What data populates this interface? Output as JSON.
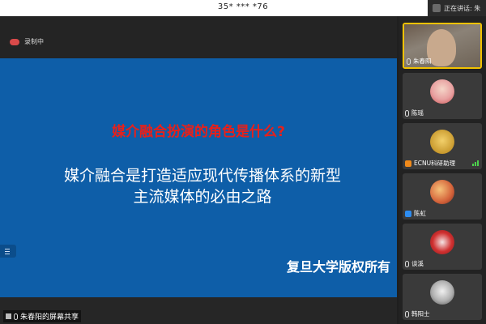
{
  "window": {
    "title": "35* *** *76"
  },
  "speaking_indicator": {
    "label": "正在讲话: 朱"
  },
  "recording": {
    "label": "录制中"
  },
  "slide": {
    "question": "媒介融合扮演的角色是什么?",
    "answer_line1": "媒介融合是打造适应现代传播体系的新型",
    "answer_line2": "主流媒体的必由之路",
    "copyright": "复旦大学版权所有"
  },
  "screen_share": {
    "label": "朱春阳的屏幕共享"
  },
  "participants": [
    {
      "name": "朱春阳",
      "icon": "mic-icon",
      "avatar": "camera-video"
    },
    {
      "name": "陈瑶",
      "icon": "mic-icon",
      "avatar": "cartoon-girl"
    },
    {
      "name": "ECNU科研助理",
      "icon": "person-icon",
      "avatar": "cartoon-character"
    },
    {
      "name": "陈虹",
      "icon": "person-icon",
      "avatar": "sunset-photo"
    },
    {
      "name": "谈溪",
      "icon": "mic-icon",
      "avatar": "red-flowers"
    },
    {
      "name": "韩阳士",
      "icon": "mic-icon",
      "avatar": "anime-sketch"
    }
  ],
  "colors": {
    "slide_background": "#0e5ea8",
    "question_text": "#e8201a",
    "active_speaker_border": "#f2c200",
    "audio_level": "#4cd14c"
  }
}
